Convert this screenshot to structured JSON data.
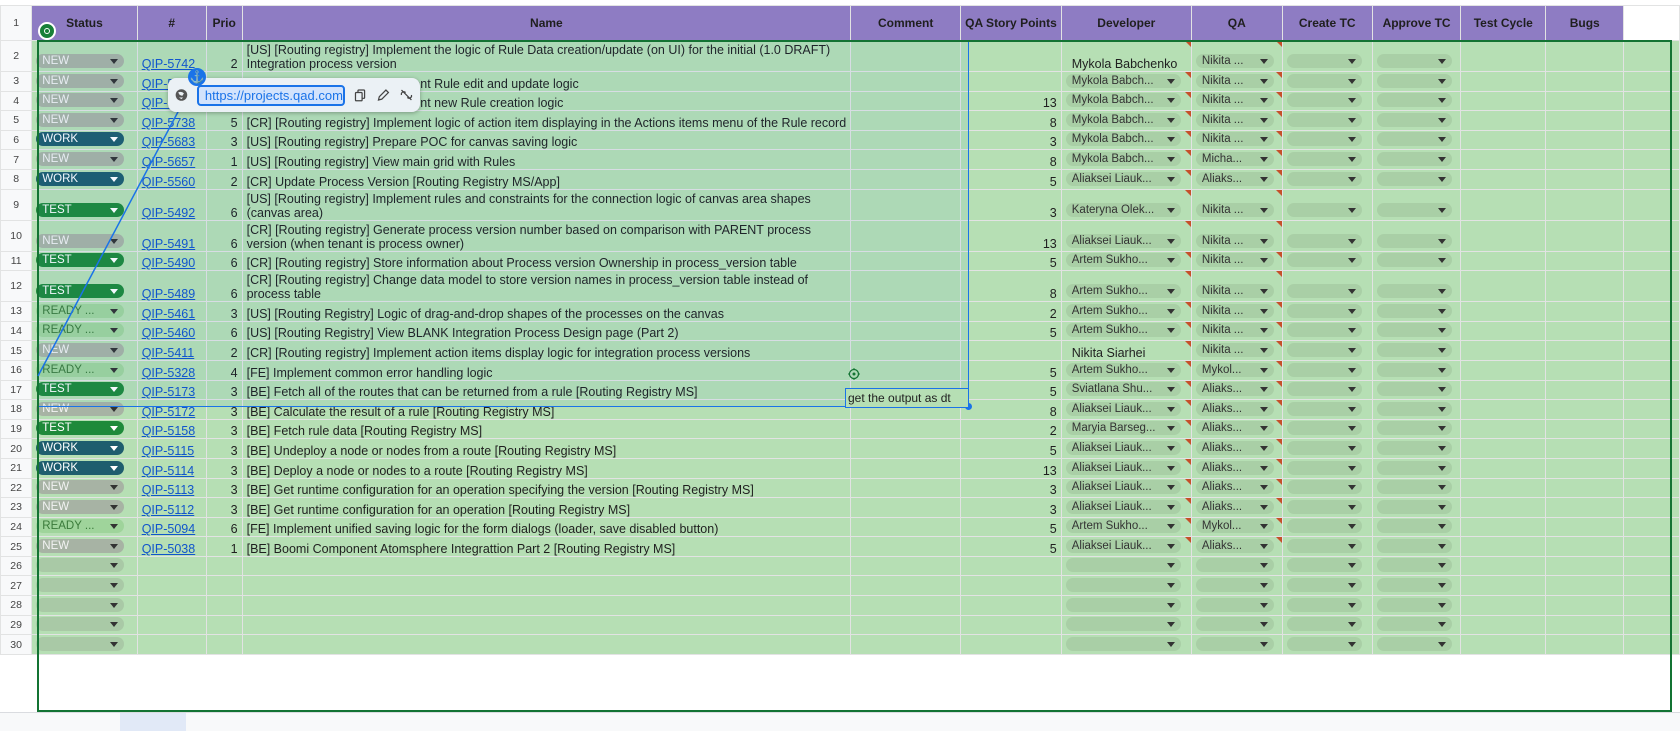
{
  "headers": {
    "row_num": "1",
    "status": "Status",
    "num": "#",
    "prio": "Prio",
    "name": "Name",
    "comment": "Comment",
    "qa_points": "QA Story Points",
    "developer": "Developer",
    "qa": "QA",
    "create_tc": "Create TC",
    "approve_tc": "Approve TC",
    "test_cycle": "Test Cycle",
    "bugs": "Bugs"
  },
  "rows": [
    {
      "n": "2",
      "status": "NEW",
      "num": "QIP-5742",
      "prio": "2",
      "name": "[US] [Routing registry] Implement the logic of Rule Data creation/update (on UI) for the initial (1.0 DRAFT) Integration process version",
      "comment": "",
      "pts": "",
      "dev": "Mykola Babchenko",
      "dev_chip": false,
      "qa": "Nikita ...",
      "tall": true
    },
    {
      "n": "3",
      "status": "NEW",
      "num": "QIP-5741",
      "prio": "",
      "name": "[US] [Routing registry] Implement Rule edit and update logic",
      "comment": "",
      "pts": "",
      "dev": "Mykola Babch...",
      "dev_chip": true,
      "qa": "Nikita ...",
      "tall": false
    },
    {
      "n": "4",
      "status": "NEW",
      "num": "QIP-5740",
      "prio": "",
      "name": "[US] [Routing registry] Implement new Rule creation logic",
      "comment": "",
      "pts": "13",
      "dev": "Mykola Babch...",
      "dev_chip": true,
      "qa": "Nikita ...",
      "tall": false
    },
    {
      "n": "5",
      "status": "NEW",
      "num": "QIP-5738",
      "prio": "5",
      "name": "[CR] [Routing registry] Implement logic of action item displaying in the Actions items menu of the Rule record",
      "comment": "",
      "pts": "8",
      "dev": "Mykola Babch...",
      "dev_chip": true,
      "qa": "Nikita ...",
      "tall": false
    },
    {
      "n": "6",
      "status": "WORK",
      "num": "QIP-5683",
      "prio": "3",
      "name": "[US] [Routing registry] Prepare POC for canvas saving logic",
      "comment": "",
      "pts": "3",
      "dev": "Mykola Babch...",
      "dev_chip": true,
      "qa": "Nikita ...",
      "tall": false
    },
    {
      "n": "7",
      "status": "NEW",
      "num": "QIP-5657",
      "prio": "1",
      "name": "[US] [Routing registry] View main grid with Rules",
      "comment": "",
      "pts": "8",
      "dev": "Mykola Babch...",
      "dev_chip": true,
      "qa": "Micha...",
      "tall": false
    },
    {
      "n": "8",
      "status": "WORK",
      "num": "QIP-5560",
      "prio": "2",
      "name": "[CR] Update Process Version [Routing Registry MS/App]",
      "comment": "",
      "pts": "5",
      "dev": "Aliaksei Liauk...",
      "dev_chip": true,
      "qa": "Aliaks...",
      "tall": false
    },
    {
      "n": "9",
      "status": "TEST",
      "num": "QIP-5492",
      "prio": "6",
      "name": "[US] [Routing registry] Implement rules and constraints for the connection logic of canvas area shapes (canvas area)",
      "comment": "",
      "pts": "3",
      "dev": "Kateryna Olek...",
      "dev_chip": true,
      "qa": "Nikita ...",
      "tall": true
    },
    {
      "n": "10",
      "status": "NEW",
      "num": "QIP-5491",
      "prio": "6",
      "name": "[CR] [Routing registry] Generate process version number based on comparison with PARENT process version (when tenant is process owner)",
      "comment": "",
      "pts": "13",
      "dev": "Aliaksei Liauk...",
      "dev_chip": true,
      "qa": "Nikita ...",
      "tall": true
    },
    {
      "n": "11",
      "status": "TEST",
      "num": "QIP-5490",
      "prio": "6",
      "name": "[CR] [Routing registry] Store information about Process version Ownership in process_version table",
      "comment": "",
      "pts": "5",
      "dev": "Artem Sukho...",
      "dev_chip": true,
      "qa": "Nikita ...",
      "tall": false
    },
    {
      "n": "12",
      "status": "TEST",
      "num": "QIP-5489",
      "prio": "6",
      "name": "[CR] [Routing registry] Change data model to store version names in process_version table instead of process table",
      "comment": "",
      "pts": "8",
      "dev": "Artem Sukho...",
      "dev_chip": true,
      "qa": "Nikita ...",
      "tall": true
    },
    {
      "n": "13",
      "status": "READY ...",
      "num": "QIP-5461",
      "prio": "3",
      "name": "[US] [Routing Registry] Logic of drag-and-drop shapes of the processes on the canvas",
      "comment": "",
      "pts": "2",
      "dev": "Artem Sukho...",
      "dev_chip": true,
      "qa": "Nikita ...",
      "tall": false
    },
    {
      "n": "14",
      "status": "READY ...",
      "num": "QIP-5460",
      "prio": "6",
      "name": "[US] [Routing Registry] View BLANK Integration Process Design page (Part 2)",
      "comment": "",
      "pts": "5",
      "dev": "Artem Sukho...",
      "dev_chip": true,
      "qa": "Nikita ...",
      "tall": false
    },
    {
      "n": "15",
      "status": "NEW",
      "num": "QIP-5411",
      "prio": "2",
      "name": "[CR] [Routing registry] Implement action items display logic for integration process versions",
      "comment": "",
      "pts": "",
      "dev": "Nikita Siarhei",
      "dev_chip": false,
      "qa": "Nikita ...",
      "tall": false
    },
    {
      "n": "16",
      "status": "READY ...",
      "num": "QIP-5328",
      "prio": "4",
      "name": "[FE] Implement common error handling logic",
      "comment": "get the output as dt",
      "pts": "5",
      "dev": "Artem Sukho...",
      "dev_chip": true,
      "qa": "Mykol...",
      "tall": false
    },
    {
      "n": "17",
      "status": "TEST",
      "num": "QIP-5173",
      "prio": "3",
      "name": "[BE] Fetch all of the routes that can be returned from a rule [Routing Registry MS]",
      "comment": "",
      "pts": "5",
      "dev": "Sviatlana Shu...",
      "dev_chip": true,
      "qa": "Aliaks...",
      "tall": false
    },
    {
      "n": "18",
      "status": "NEW",
      "num": "QIP-5172",
      "prio": "3",
      "name": "[BE] Calculate the result of a rule [Routing Registry MS]",
      "comment": "",
      "pts": "8",
      "dev": "Aliaksei Liauk...",
      "dev_chip": true,
      "qa": "Aliaks...",
      "tall": false
    },
    {
      "n": "19",
      "status": "TEST",
      "num": "QIP-5158",
      "prio": "3",
      "name": "[BE] Fetch rule data [Routing Registry MS]",
      "comment": "",
      "pts": "2",
      "dev": "Maryia Barseg...",
      "dev_chip": true,
      "qa": "Aliaks...",
      "tall": false
    },
    {
      "n": "20",
      "status": "WORK",
      "num": "QIP-5115",
      "prio": "3",
      "name": "[BE] Undeploy a node or nodes from a route [Routing Registry MS]",
      "comment": "",
      "pts": "5",
      "dev": "Aliaksei Liauk...",
      "dev_chip": true,
      "qa": "Aliaks...",
      "tall": false
    },
    {
      "n": "21",
      "status": "WORK",
      "num": "QIP-5114",
      "prio": "3",
      "name": "[BE] Deploy a node or nodes to a route [Routing Registry MS]",
      "comment": "",
      "pts": "13",
      "dev": "Aliaksei Liauk...",
      "dev_chip": true,
      "qa": "Aliaks...",
      "tall": false
    },
    {
      "n": "22",
      "status": "NEW",
      "num": "QIP-5113",
      "prio": "3",
      "name": "[BE] Get runtime configuration for an operation specifying the version [Routing Registry MS]",
      "comment": "",
      "pts": "3",
      "dev": "Aliaksei Liauk...",
      "dev_chip": true,
      "qa": "Aliaks...",
      "tall": false
    },
    {
      "n": "23",
      "status": "NEW",
      "num": "QIP-5112",
      "prio": "3",
      "name": "[BE] Get runtime configuration for an operation [Routing Registry MS]",
      "comment": "",
      "pts": "3",
      "dev": "Aliaksei Liauk...",
      "dev_chip": true,
      "qa": "Aliaks...",
      "tall": false
    },
    {
      "n": "24",
      "status": "READY ...",
      "num": "QIP-5094",
      "prio": "6",
      "name": "[FE] Implement unified saving logic for the form dialogs (loader, save disabled button)",
      "comment": "",
      "pts": "5",
      "dev": "Artem Sukho...",
      "dev_chip": true,
      "qa": "Mykol...",
      "tall": false
    },
    {
      "n": "25",
      "status": "NEW",
      "num": "QIP-5038",
      "prio": "1",
      "name": "[BE] Boomi Component Atomsphere Integrattion Part 2 [Routing Registry MS]",
      "comment": "",
      "pts": "5",
      "dev": "Aliaksei Liauk...",
      "dev_chip": true,
      "qa": "Aliaks...",
      "tall": false
    }
  ],
  "empty_rows": [
    "26",
    "27",
    "28",
    "29",
    "30"
  ],
  "link_popup": {
    "url": "https://projects.qad.com/..."
  },
  "colors": {
    "header": "#8e7cc3",
    "row_fill": "#b6dfb4",
    "selection": "#137333",
    "active": "#1a73e8"
  }
}
